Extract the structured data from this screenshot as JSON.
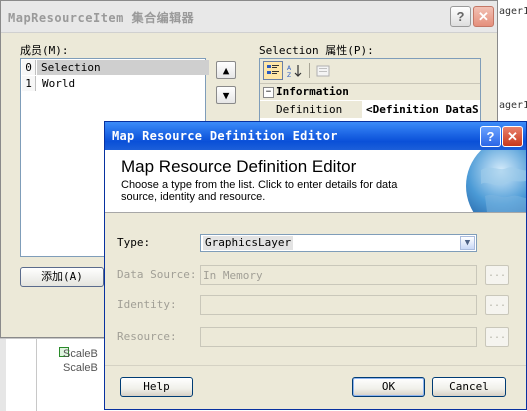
{
  "background": {
    "right_labels": [
      "ager1",
      "ager1"
    ],
    "scale_labels": [
      "ScaleB",
      "ScaleB"
    ]
  },
  "collection_editor": {
    "title": "MapResourceItem 集合编辑器",
    "help_glyph": "?",
    "close_glyph": "✕",
    "members_label": "成员(M):",
    "members": [
      {
        "index": "0",
        "name": "Selection",
        "selected": true
      },
      {
        "index": "1",
        "name": "World",
        "selected": false
      }
    ],
    "move_up_icon": "▲",
    "move_down_icon": "▼",
    "add_button": "添加(A)",
    "properties_label": "Selection 属性(P):",
    "toolbar_icons": [
      "categorized-icon",
      "alphabetical-icon",
      "property-pages-icon"
    ],
    "category": {
      "expander": "−",
      "name": "Information"
    },
    "property": {
      "name": "Definition",
      "value": "<Definition DataS"
    }
  },
  "definition_editor": {
    "title": "Map Resource Definition Editor",
    "help_glyph": "?",
    "close_glyph": "✕",
    "header_title": "Map Resource Definition Editor",
    "header_description": "Choose a type from the list. Click to enter details for data source, identity and resource.",
    "type_label": "Type:",
    "type_value": "GraphicsLayer",
    "data_source_label": "Data Source:",
    "data_source_value": "In Memory",
    "identity_label": "Identity:",
    "identity_value": "",
    "resource_label": "Resource:",
    "resource_value": "",
    "ellipsis": "...",
    "help_button": "Help",
    "ok_button": "OK",
    "cancel_button": "Cancel"
  },
  "colors": {
    "active_title": "#0a50d8",
    "dialog_face": "#ece9d8",
    "disabled_text": "#a19f96"
  }
}
